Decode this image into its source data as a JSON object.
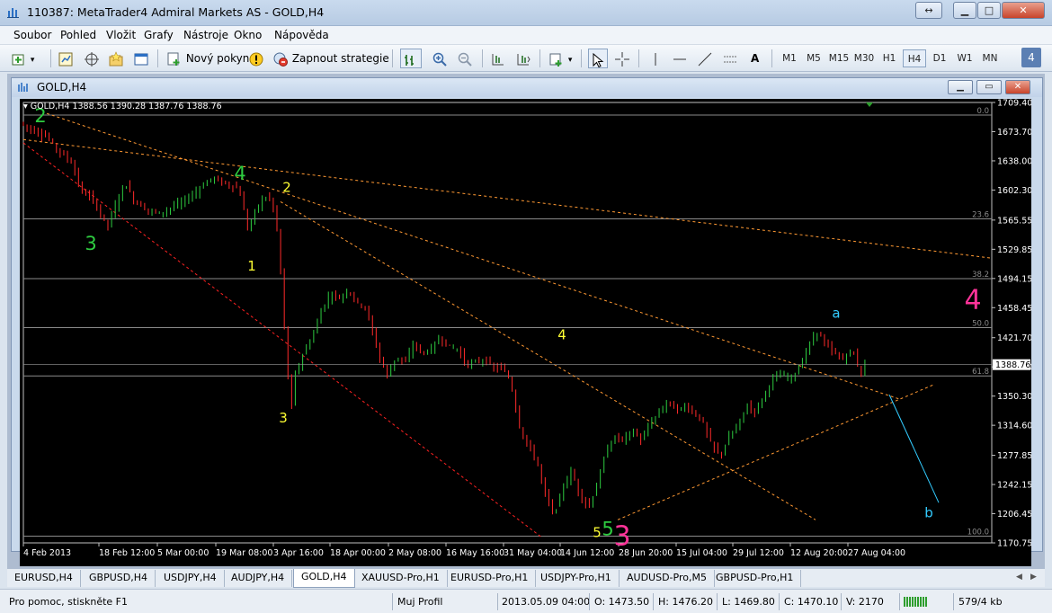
{
  "window": {
    "title": "110387: MetaTrader4 Admiral Markets AS - GOLD,H4"
  },
  "menu": {
    "items": [
      "Soubor",
      "Pohled",
      "Vložit",
      "Grafy",
      "Nástroje",
      "Okno",
      "Nápověda"
    ]
  },
  "toolbar": {
    "new_order_label": "Nový pokyn",
    "expert_label": "Zapnout strategie",
    "line_tool_label": "A",
    "timeframes": [
      "M1",
      "M5",
      "M15",
      "M30",
      "H1",
      "H4",
      "D1",
      "W1",
      "MN"
    ],
    "active_timeframe": "H4",
    "badge": "4"
  },
  "chart_window": {
    "title": "GOLD,H4"
  },
  "chart": {
    "info_line": "GOLD,H4  1388.56 1390.28 1387.76 1388.76",
    "current_price": "1388.76",
    "colors": {
      "bull": "#2ecc40",
      "bear": "#ff2a2a",
      "fibo": "#8a8a8a",
      "trend": "#ff9933",
      "diag": "#ff2222",
      "wave_b": "#33ccff"
    }
  },
  "chart_data": {
    "type": "candlestick",
    "y_ticks": [
      "1709.40",
      "1673.70",
      "1638.00",
      "1602.30",
      "1565.55",
      "1529.85",
      "1494.15",
      "1458.45",
      "1421.70",
      "1386.00",
      "1350.30",
      "1314.60",
      "1277.85",
      "1242.15",
      "1206.45",
      "1170.75"
    ],
    "ylim": [
      1170.75,
      1709.4
    ],
    "x_ticks": [
      "4 Feb 2013",
      "18 Feb 12:00",
      "5 Mar 00:00",
      "19 Mar 08:00",
      "3 Apr 16:00",
      "18 Apr 00:00",
      "2 May 08:00",
      "16 May 16:00",
      "31 May 04:00",
      "14 Jun 12:00",
      "28 Jun 20:00",
      "15 Jul 04:00",
      "29 Jul 12:00",
      "12 Aug 20:00",
      "27 Aug 04:00"
    ],
    "fibo_levels": [
      {
        "label": "0.0",
        "price": 1694
      },
      {
        "label": "23.6",
        "price": 1567
      },
      {
        "label": "38.2",
        "price": 1494
      },
      {
        "label": "50.0",
        "price": 1434
      },
      {
        "label": "61.8",
        "price": 1375
      },
      {
        "label": "100.0",
        "price": 1179
      }
    ],
    "price_path": [
      [
        0,
        1685
      ],
      [
        3,
        1675
      ],
      [
        6,
        1668
      ],
      [
        9,
        1650
      ],
      [
        12,
        1635
      ],
      [
        14,
        1600
      ],
      [
        16,
        1595
      ],
      [
        18,
        1578
      ],
      [
        20,
        1558
      ],
      [
        22,
        1585
      ],
      [
        24,
        1612
      ],
      [
        26,
        1590
      ],
      [
        29,
        1578
      ],
      [
        32,
        1574
      ],
      [
        35,
        1582
      ],
      [
        38,
        1590
      ],
      [
        41,
        1604
      ],
      [
        44,
        1618
      ],
      [
        46,
        1612
      ],
      [
        48,
        1608
      ],
      [
        50,
        1604
      ],
      [
        51,
        1582
      ],
      [
        52,
        1555
      ],
      [
        54,
        1578
      ],
      [
        55,
        1590
      ],
      [
        57,
        1594
      ],
      [
        58,
        1578
      ],
      [
        59,
        1545
      ],
      [
        60,
        1470
      ],
      [
        61,
        1385
      ],
      [
        62,
        1335
      ],
      [
        63,
        1380
      ],
      [
        65,
        1405
      ],
      [
        67,
        1425
      ],
      [
        69,
        1458
      ],
      [
        71,
        1475
      ],
      [
        73,
        1470
      ],
      [
        75,
        1480
      ],
      [
        77,
        1465
      ],
      [
        79,
        1458
      ],
      [
        80,
        1440
      ],
      [
        82,
        1400
      ],
      [
        84,
        1375
      ],
      [
        86,
        1400
      ],
      [
        88,
        1390
      ],
      [
        90,
        1415
      ],
      [
        92,
        1402
      ],
      [
        94,
        1408
      ],
      [
        96,
        1422
      ],
      [
        98,
        1410
      ],
      [
        100,
        1408
      ],
      [
        102,
        1388
      ],
      [
        104,
        1392
      ],
      [
        106,
        1395
      ],
      [
        108,
        1385
      ],
      [
        110,
        1385
      ],
      [
        112,
        1370
      ],
      [
        114,
        1315
      ],
      [
        116,
        1290
      ],
      [
        118,
        1272
      ],
      [
        120,
        1230
      ],
      [
        122,
        1205
      ],
      [
        124,
        1238
      ],
      [
        126,
        1258
      ],
      [
        128,
        1228
      ],
      [
        130,
        1215
      ],
      [
        132,
        1245
      ],
      [
        134,
        1285
      ],
      [
        136,
        1300
      ],
      [
        138,
        1298
      ],
      [
        140,
        1308
      ],
      [
        142,
        1295
      ],
      [
        144,
        1318
      ],
      [
        146,
        1330
      ],
      [
        148,
        1345
      ],
      [
        150,
        1332
      ],
      [
        152,
        1338
      ],
      [
        154,
        1330
      ],
      [
        156,
        1318
      ],
      [
        158,
        1290
      ],
      [
        160,
        1278
      ],
      [
        162,
        1300
      ],
      [
        164,
        1315
      ],
      [
        166,
        1338
      ],
      [
        168,
        1332
      ],
      [
        170,
        1352
      ],
      [
        172,
        1372
      ],
      [
        174,
        1376
      ],
      [
        176,
        1372
      ],
      [
        178,
        1385
      ],
      [
        180,
        1410
      ],
      [
        182,
        1430
      ],
      [
        184,
        1413
      ],
      [
        186,
        1403
      ],
      [
        188,
        1395
      ],
      [
        190,
        1408
      ],
      [
        192,
        1378
      ],
      [
        193,
        1388
      ]
    ],
    "wave_labels": [
      {
        "text": "2",
        "color": "#2ecc40",
        "size": "big",
        "price": 1685,
        "x": 45
      },
      {
        "text": "3",
        "color": "#2ecc40",
        "size": "big",
        "price": 1529,
        "x": 101
      },
      {
        "text": "4",
        "color": "#2ecc40",
        "size": "big",
        "price": 1615,
        "x": 267
      },
      {
        "text": "2",
        "color": "#ffff33",
        "size": "mid",
        "price": 1600,
        "x": 319
      },
      {
        "text": "1",
        "color": "#ffff33",
        "size": "mid",
        "price": 1504,
        "x": 280
      },
      {
        "text": "3",
        "color": "#ffff33",
        "size": "mid",
        "price": 1318,
        "x": 315
      },
      {
        "text": "4",
        "color": "#ffff33",
        "size": "mid",
        "price": 1420,
        "x": 625
      },
      {
        "text": "5",
        "color": "#ffff33",
        "size": "mid",
        "price": 1178,
        "x": 664
      },
      {
        "text": "5",
        "color": "#2ecc40",
        "size": "big",
        "price": 1180,
        "x": 676
      },
      {
        "text": "3",
        "color": "#ff3399",
        "size": "huge",
        "price": 1168,
        "x": 692
      },
      {
        "text": "a",
        "color": "#33ccff",
        "size": "mid",
        "price": 1446,
        "x": 930
      },
      {
        "text": "b",
        "color": "#33ccff",
        "size": "mid",
        "price": 1202,
        "x": 1033
      },
      {
        "text": "4",
        "color": "#ff3399",
        "size": "huge",
        "price": 1457,
        "x": 1082
      }
    ]
  },
  "symbol_tabs": [
    "EURUSD,H4",
    "GBPUSD,H4",
    "USDJPY,H4",
    "AUDJPY,H4",
    "GOLD,H4",
    "XAUUSD-Pro,H1",
    "EURUSD-Pro,H1",
    "USDJPY-Pro,H1",
    "AUDUSD-Pro,M5",
    "GBPUSD-Pro,H1"
  ],
  "active_tab": "GOLD,H4",
  "status": {
    "help": "Pro pomoc, stiskněte F1",
    "profile": "Muj Profil",
    "datetime": "2013.05.09 04:00",
    "open": "O: 1473.50",
    "high": "H: 1476.20",
    "low": "L: 1469.80",
    "close": "C: 1470.10",
    "volume": "V: 2170",
    "traffic": "579/4 kb"
  }
}
